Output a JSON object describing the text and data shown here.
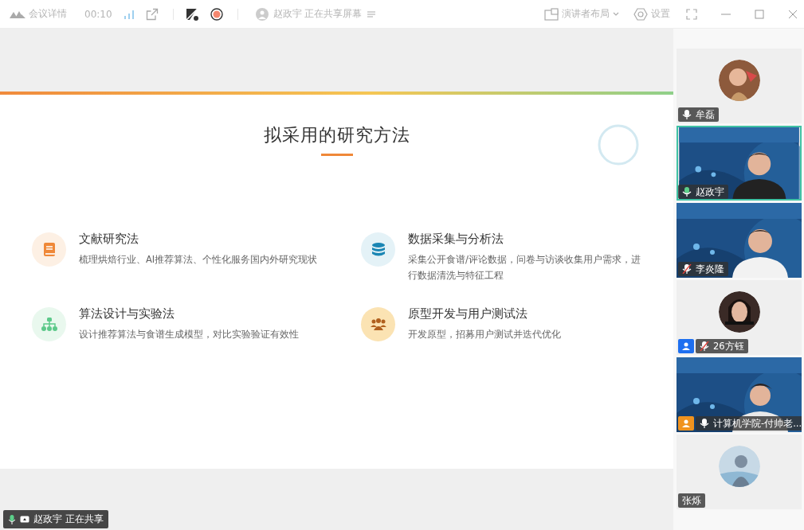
{
  "toolbar": {
    "meeting_details": "会议详情",
    "elapsed": "00:10",
    "recording": true,
    "sharer": "赵政宇 正在共享屏幕",
    "layout": "演讲者布局",
    "settings": "设置"
  },
  "slide": {
    "title": "拟采用的研究方法",
    "methods": [
      {
        "title": "文献研究法",
        "description": "梳理烘焙行业、AI推荐算法、个性化服务国内外研究现状",
        "kind": "book",
        "color": "#ef8838"
      },
      {
        "title": "数据采集与分析法",
        "description": "采集公开食谱/评论数据，问卷与访谈收集用户需求，进行数据清洗与特征工程",
        "kind": "database",
        "color": "#1a86b4"
      },
      {
        "title": "算法设计与实验法",
        "description": "设计推荐算法与食谱生成模型，对比实验验证有效性",
        "kind": "hierarchy",
        "color": "#5cc98a"
      },
      {
        "title": "原型开发与用户测试法",
        "description": "开发原型，招募用户测试并迭代优化",
        "kind": "people",
        "color": "#b0601e"
      }
    ]
  },
  "participants": [
    {
      "name": "牟磊",
      "kind": "avatar",
      "muted": false,
      "speaking": false,
      "selected": false
    },
    {
      "name": "赵政宇",
      "kind": "video",
      "muted": false,
      "speaking": true,
      "selected": true
    },
    {
      "name": "李炎隆",
      "kind": "video",
      "muted": true,
      "speaking": false,
      "selected": false
    },
    {
      "name": "26方钰",
      "kind": "avatar",
      "muted": true,
      "speaking": false,
      "selected": false,
      "color": "#1e6ff0"
    },
    {
      "name": "计算机学院-付帅老...",
      "kind": "video",
      "muted": false,
      "speaking": false,
      "selected": false,
      "color": "#f0931e"
    },
    {
      "name": "张烁",
      "kind": "avatar",
      "selected": false
    }
  ],
  "share_badge": "赵政宇 正在共享"
}
